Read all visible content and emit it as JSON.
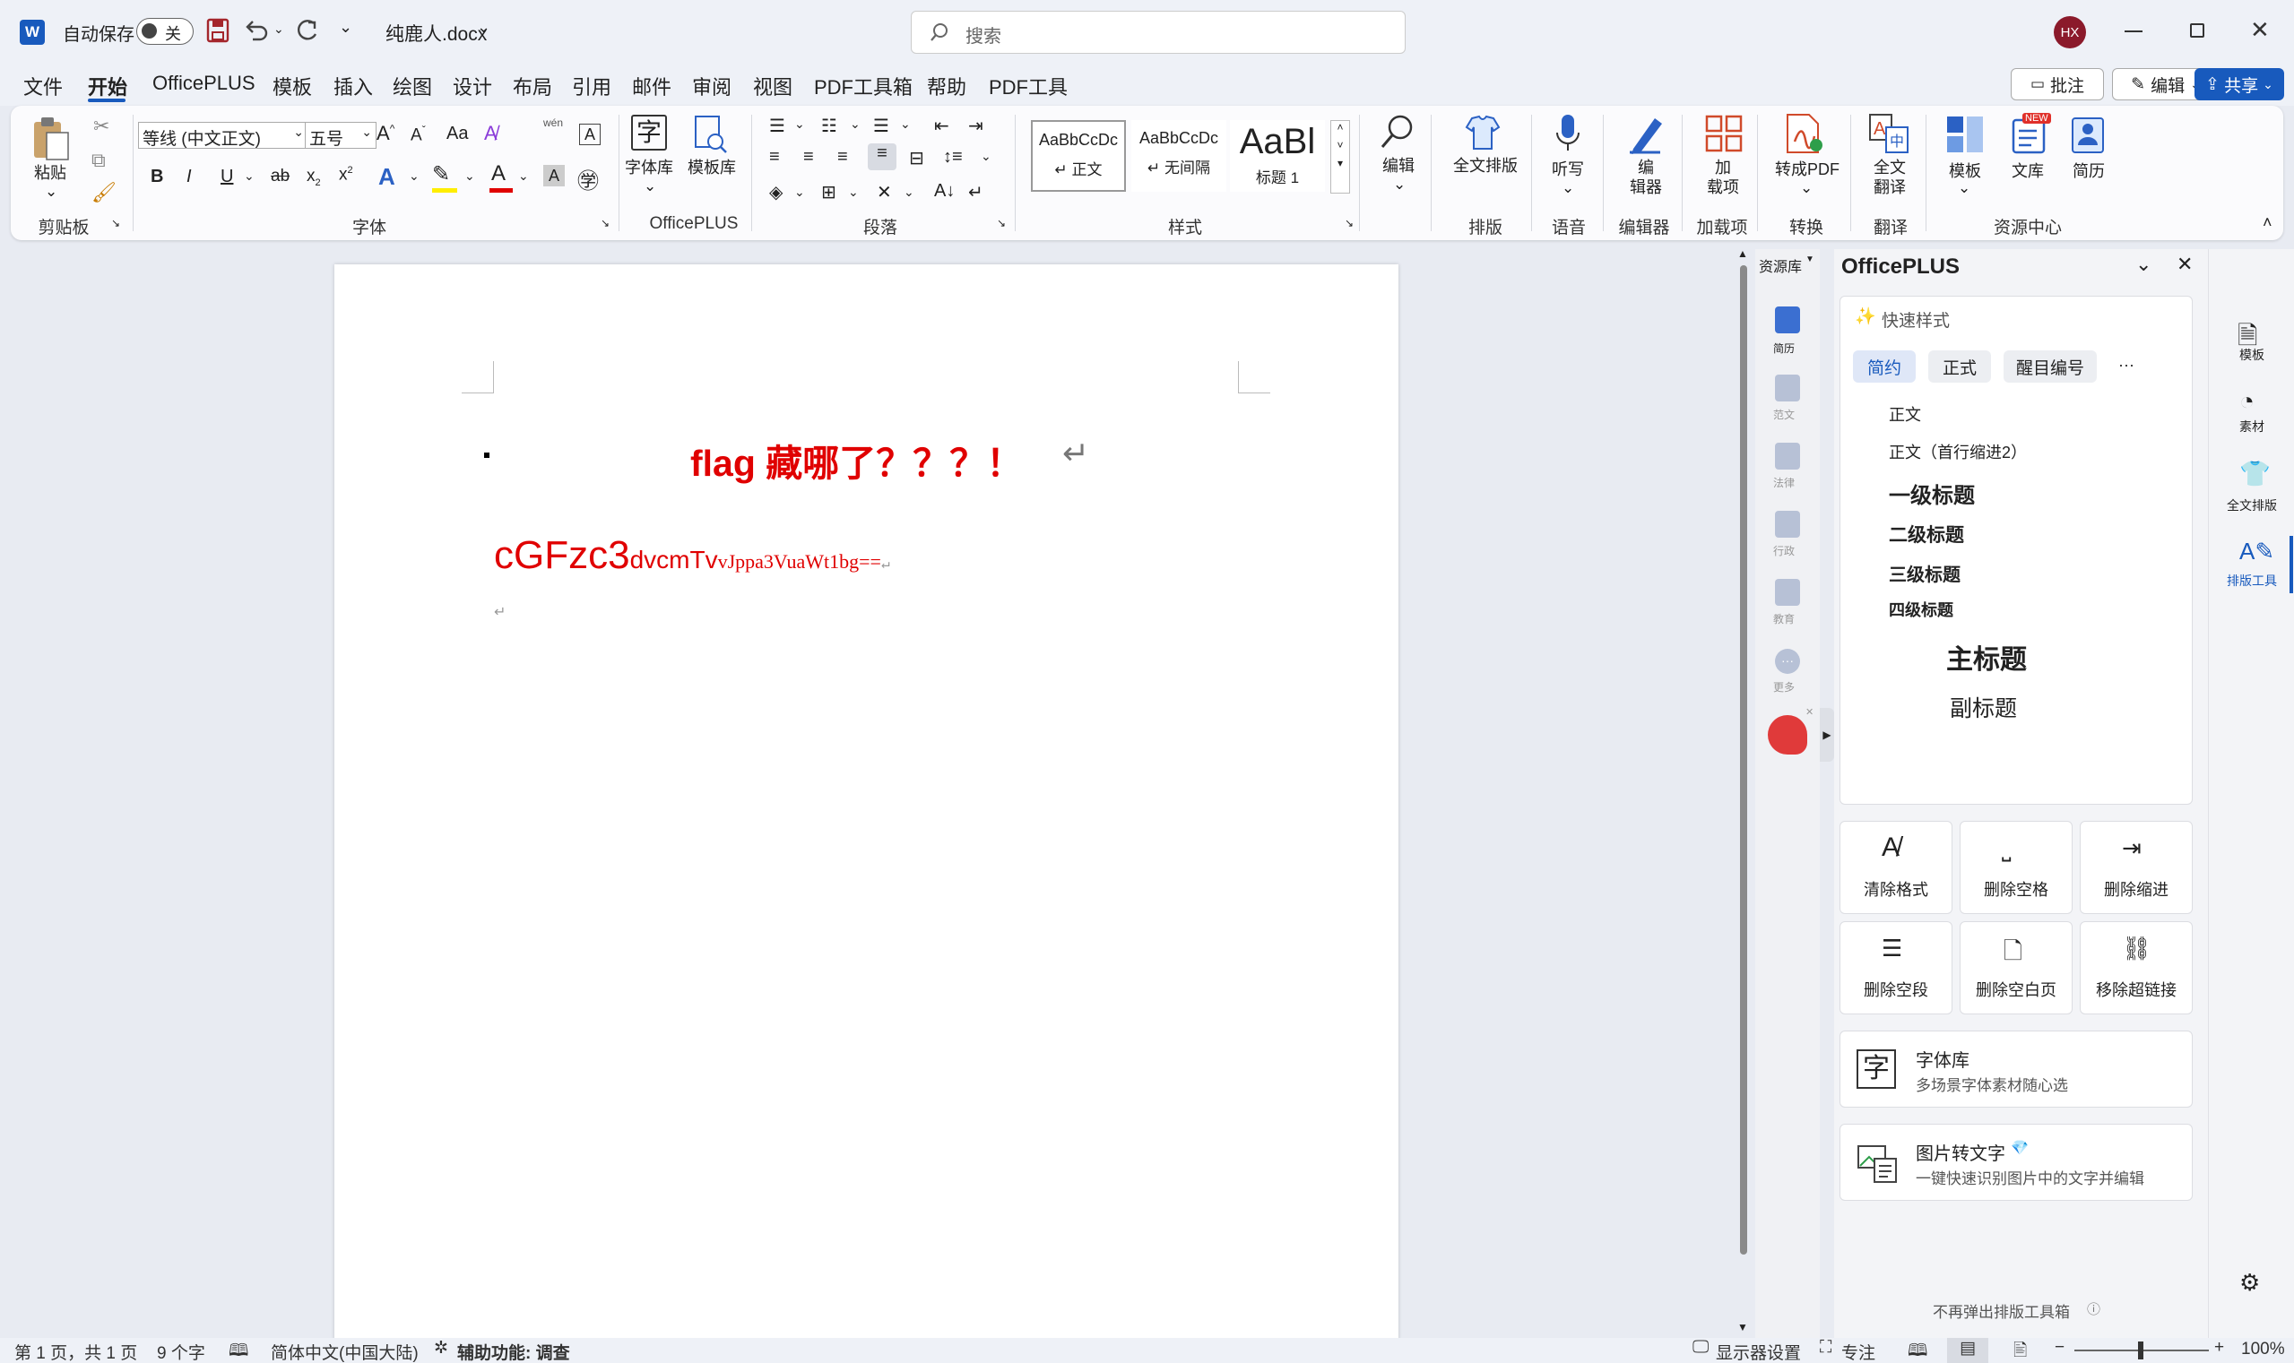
{
  "titlebar": {
    "autosave_label": "自动保存",
    "autosave_state": "关",
    "filename": "纯鹿人.docx",
    "search_placeholder": "搜索",
    "avatar_initials": "HX"
  },
  "menu": {
    "items": [
      "文件",
      "开始",
      "OfficePLUS",
      "模板",
      "插入",
      "绘图",
      "设计",
      "布局",
      "引用",
      "邮件",
      "审阅",
      "视图",
      "PDF工具箱",
      "帮助",
      "PDF工具"
    ],
    "active": "开始",
    "comment_btn": "批注",
    "edit_btn": "编辑",
    "share_btn": "共享"
  },
  "ribbon": {
    "paste": "粘贴",
    "font_name": "等线 (中文正文)",
    "font_size": "五号",
    "case_btn": "Aa",
    "wen": "wén",
    "char_border": "A",
    "fontlib": "字体库",
    "templatelib": "模板库",
    "styles": [
      {
        "preview": "AaBbCcDc",
        "name": "正文"
      },
      {
        "preview": "AaBbCcDc",
        "name": "无间隔"
      },
      {
        "preview": "AaBl",
        "name": "标题 1"
      }
    ],
    "edit": "编辑",
    "fulltext_layout": "全文排版",
    "dictate": "听写",
    "editor": [
      "编",
      "辑器"
    ],
    "addins": [
      "加",
      "载项"
    ],
    "to_pdf": "转成PDF",
    "translate": [
      "全文",
      "翻译"
    ],
    "template": "模板",
    "library": "文库",
    "resume": "简历",
    "new_badge": "NEW",
    "groups": {
      "clipboard": "剪贴板",
      "font": "字体",
      "officeplus": "OfficePLUS",
      "paragraph": "段落",
      "styles": "样式",
      "layout": "排版",
      "voice": "语音",
      "editor": "编辑器",
      "addins": "加载项",
      "convert": "转换",
      "translate": "翻译",
      "resource": "资源中心"
    }
  },
  "document": {
    "heading": "flag 藏哪了？？？！",
    "encoded_large": "cGFzc3",
    "encoded_mid": "dvcmTv",
    "encoded_small": "vJppa3VuaWt1bg==",
    "return_mark": "↵"
  },
  "sidestrip": {
    "title": "资源库",
    "items": [
      "简历",
      "范文",
      "法律",
      "行政",
      "教育",
      "更多"
    ]
  },
  "pane": {
    "title": "OfficePLUS",
    "quick_style": "快速样式",
    "tabs": [
      "简约",
      "正式",
      "醒目编号"
    ],
    "more": "···",
    "styles": [
      "正文",
      "正文（首行缩进2）",
      "一级标题",
      "二级标题",
      "三级标题",
      "四级标题",
      "主标题",
      "副标题"
    ],
    "tools": [
      "清除格式",
      "删除空格",
      "删除缩进",
      "删除空段",
      "删除空白页",
      "移除超链接"
    ],
    "fontlib_title": "字体库",
    "fontlib_desc": "多场景字体素材随心选",
    "fontlib_glyph": "字",
    "ocr_title": "图片转文字",
    "ocr_desc": "一键快速识别图片中的文字并编辑",
    "footer": "不再弹出排版工具箱"
  },
  "rightbar": {
    "items": [
      "模板",
      "素材",
      "全文排版",
      "排版工具"
    ]
  },
  "status": {
    "page": "第 1 页，共 1 页",
    "words": "9 个字",
    "lang": "简体中文(中国大陆)",
    "accessibility": "辅助功能: 调查",
    "display": "显示器设置",
    "focus": "专注",
    "zoom": "100%"
  },
  "colors": {
    "accent": "#185abd",
    "doc_red": "#e00000",
    "word_blue": "#185abd"
  }
}
